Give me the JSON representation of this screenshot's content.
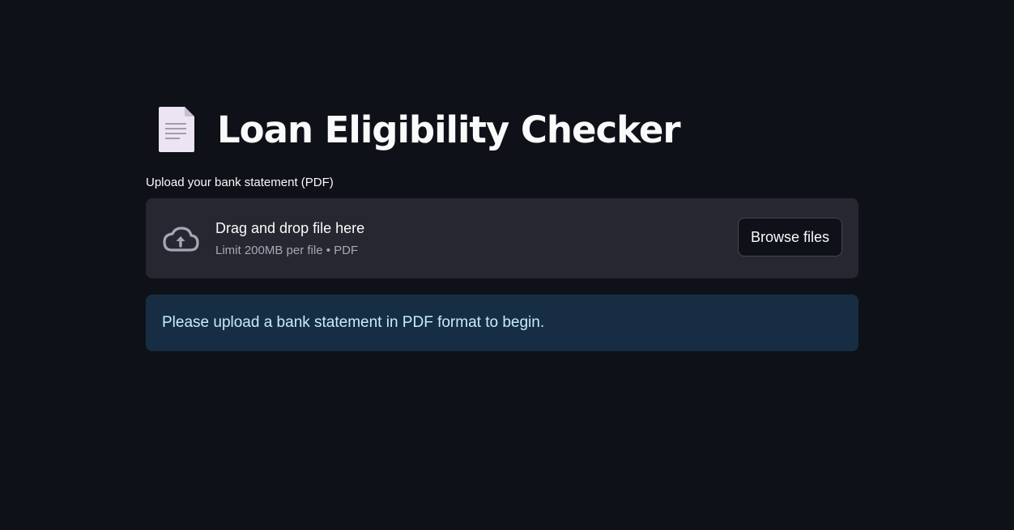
{
  "header": {
    "icon": "page-facing-up-icon",
    "title": "Loan Eligibility Checker"
  },
  "uploader": {
    "label": "Upload your bank statement (PDF)",
    "drop_text": "Drag and drop file here",
    "limit_text": "Limit 200MB per file • PDF",
    "browse_label": "Browse files",
    "icon": "cloud-upload-icon"
  },
  "info": {
    "message": "Please upload a bank statement in PDF format to begin."
  },
  "colors": {
    "background": "#0e1117",
    "dropzone": "#262730",
    "info_bg": "#172d43",
    "info_text": "#c7ebff"
  }
}
